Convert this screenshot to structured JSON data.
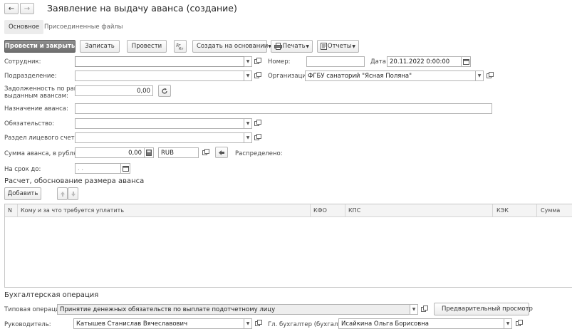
{
  "nav": {
    "back": "←",
    "forward": "→"
  },
  "window": {
    "title": "Заявление на выдачу аванса (создание)"
  },
  "tabs": [
    {
      "label": "Основное",
      "active": true
    },
    {
      "label": "Присоединенные файлы",
      "active": false
    }
  ],
  "toolbar": {
    "post_close": "Провести и закрыть",
    "save": "Записать",
    "post": "Провести",
    "create_based": "Создать на основании",
    "print": "Печать",
    "reports": "Отчеты"
  },
  "form": {
    "employee_label": "Сотрудник:",
    "employee_value": "",
    "number_label": "Номер:",
    "number_value": "",
    "date_label": "Дата:",
    "date_value": "20.11.2022  0:00:00",
    "department_label": "Подразделение:",
    "department_value": "",
    "organization_label": "Организация:",
    "organization_value": "ФГБУ санаторий \"Ясная Поляна\"",
    "debt_label_line1": "Задолженность по ранее",
    "debt_label_line2": "выданным авансам:",
    "debt_value": "0,00",
    "purpose_label": "Назначение аванса:",
    "purpose_value": "",
    "obligation_label": "Обязательство:",
    "obligation_value": "",
    "account_section_label": "Раздел лицевого счета:",
    "account_section_value": "",
    "amount_label": "Сумма аванса, в рублях:",
    "amount_value": "0,00",
    "currency_value": "RUB",
    "distributed_label": "Распределено:",
    "due_label": "На срок до:",
    "due_value": " .  .  "
  },
  "calc": {
    "title": "Расчет, обоснование размера аванса",
    "add_button": "Добавить",
    "columns": [
      "N",
      "Кому и за что требуется уплатить",
      "КФО",
      "КПС",
      "КЭК",
      "Сумма"
    ]
  },
  "accounting": {
    "title": "Бухгалтерская операция",
    "op_label": "Типовая операция:",
    "op_value": "Принятие денежных обязательств по выплате подотчетному лицу",
    "preview_button": "Предварительный просмотр",
    "head_label": "Руководитель:",
    "head_value": "Катышев Станислав Вячеславович",
    "chief_acc_label": "Гл. бухгалтер (бухгалтер):",
    "chief_acc_value": "Исайкина Ольга Борисовна"
  },
  "colors": {
    "primary_button": "#7a7a7a",
    "border": "#b3b3b3",
    "grid_bg": "#ffffff"
  }
}
